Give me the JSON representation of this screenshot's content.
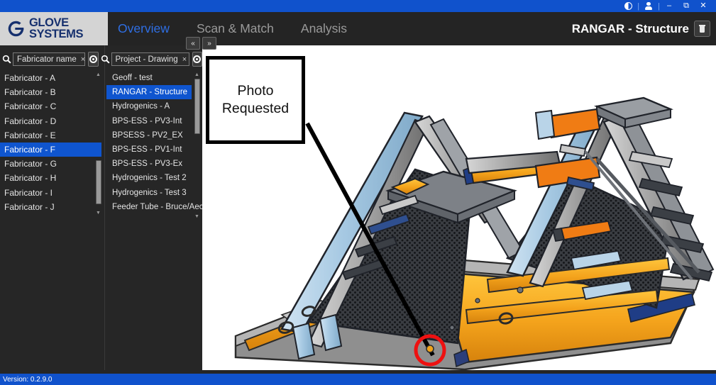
{
  "window": {
    "controls": [
      {
        "name": "contrast-toggle",
        "glyph": "contrast"
      },
      {
        "name": "user-account",
        "glyph": "person"
      },
      {
        "name": "minimize",
        "glyph": "–"
      },
      {
        "name": "restore",
        "glyph": "❐"
      },
      {
        "name": "close",
        "glyph": "✕"
      }
    ],
    "titlebar_color": "#1052cc"
  },
  "brand": {
    "line1": "GLOVE",
    "line2": "SYSTEMS",
    "logo_color": "#16306e",
    "panel_color": "#d4d4d4"
  },
  "nav": {
    "tabs": [
      {
        "label": "Overview",
        "active": true
      },
      {
        "label": "Scan & Match",
        "active": false
      },
      {
        "label": "Analysis",
        "active": false
      }
    ],
    "active_color": "#2f6fe4",
    "collapse_prev": "«",
    "collapse_next": "»"
  },
  "header": {
    "project_title": "RANGAR - Structure",
    "delete_button": "delete-project"
  },
  "search": {
    "fabricator": {
      "value": "Fabricator name",
      "clear": "×"
    },
    "project": {
      "value": "Project - Drawing",
      "clear": "×"
    }
  },
  "fabricators": {
    "selected_index": 5,
    "items": [
      "Fabricator - A",
      "Fabricator - B",
      "Fabricator - C",
      "Fabricator - D",
      "Fabricator - E",
      "Fabricator - F",
      "Fabricator - G",
      "Fabricator - H",
      "Fabricator - I",
      "Fabricator - J"
    ]
  },
  "projects": {
    "selected_index": 1,
    "items": [
      "Geoff - test",
      "RANGAR - Structure",
      "Hydrogenics - A",
      "BPS-ESS - PV3-Int",
      "BPSESS - PV2_EX",
      "BPS-ESS - PV1-Int",
      "BPS-ESS - PV3-Ex",
      "Hydrogenics - Test 2",
      "Hydrogenics - Test 3",
      "Feeder Tube - Bruce/Aecon"
    ]
  },
  "annotation": {
    "callout_line1": "Photo",
    "callout_line2": "Requested",
    "marker_color": "#ee1111",
    "leader_color": "#000000"
  },
  "status": {
    "version": "Version: 0.2.9.0"
  },
  "colors": {
    "selection_blue": "#0f55cf",
    "sidebar_bg": "#262626",
    "viewport_bg": "#ffffff",
    "model_yellow": "#f2a31b",
    "model_blue": "#a8cbe6",
    "model_gray": "#9a9a9a"
  }
}
